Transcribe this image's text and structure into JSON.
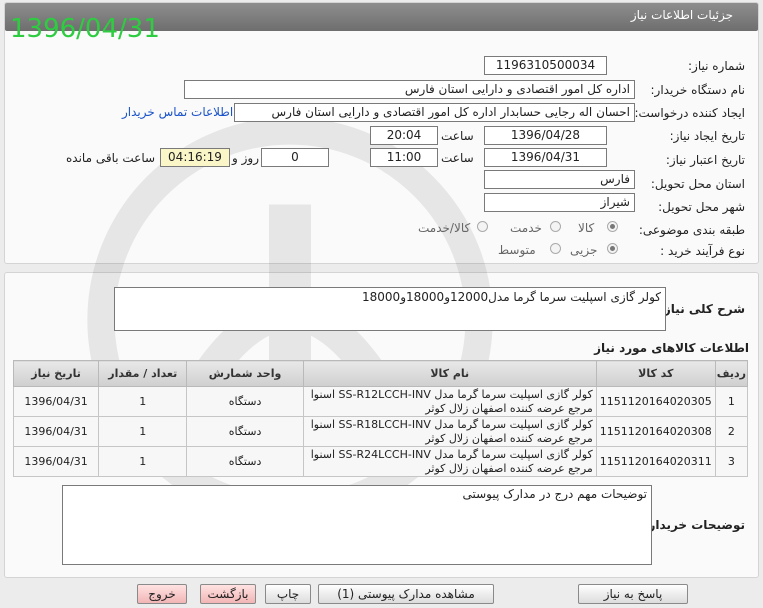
{
  "header": {
    "title": "جزئیات اطلاعات نیاز"
  },
  "stamp_date": "1396/04/31",
  "form": {
    "need_number": {
      "label": "شماره نیاز:",
      "value": "1196310500034"
    },
    "buyer_org": {
      "label": "نام دستگاه خریدار:",
      "value": "اداره کل امور اقتصادی و دارایی استان فارس"
    },
    "requester": {
      "label": "ایجاد کننده درخواست:",
      "value": "احسان اله  رجایی حسابدار اداره کل امور اقتصادی و دارایی استان فارس",
      "contact_link": "اطلاعات تماس خریدار"
    },
    "created": {
      "label": "تاریخ ایجاد نیاز:",
      "date": "1396/04/28",
      "time_label": "ساعت",
      "time": "20:04"
    },
    "validity": {
      "label": "تاریخ اعتبار نیاز:",
      "date": "1396/04/31",
      "time_label": "ساعت",
      "time": "11:00",
      "days": "0",
      "days_label": "روز و",
      "remaining": "04:16:19",
      "remaining_label": "ساعت باقی مانده"
    },
    "province": {
      "label": "استان محل تحویل:",
      "value": "فارس"
    },
    "city": {
      "label": "شهر محل تحویل:",
      "value": "شیراز"
    },
    "category": {
      "label": "طبقه بندی موضوعی:",
      "options": [
        "کالا",
        "خدمت",
        "کالا/خدمت"
      ],
      "selected": 0
    },
    "process": {
      "label": "نوع فرآیند خرید :",
      "options": [
        "جزیی",
        "متوسط"
      ],
      "selected": 0
    }
  },
  "summary": {
    "label": "شرح کلی نیاز:",
    "value": "کولر گازی اسپلیت سرما گرما مدل12000و18000و18000"
  },
  "items_section": {
    "title": "اطلاعات کالاهای مورد نیاز",
    "columns": [
      "ردیف",
      "کد کالا",
      "نام کالا",
      "واحد شمارش",
      "تعداد / مقدار",
      "تاریخ نیاز"
    ],
    "rows": [
      {
        "row": "1",
        "code": "1151120164020305",
        "name_line1": "کولر گازی اسپلیت سرما گرما مدل SS-R12LCCH-INV اسنوا",
        "name_line2": "مرجع عرضه کننده اصفهان زلال کوثر",
        "unit": "دستگاه",
        "qty": "1",
        "date": "1396/04/31"
      },
      {
        "row": "2",
        "code": "1151120164020308",
        "name_line1": "کولر گازی اسپلیت سرما گرما مدل SS-R18LCCH-INV اسنوا",
        "name_line2": "مرجع عرضه کننده اصفهان زلال کوثر",
        "unit": "دستگاه",
        "qty": "1",
        "date": "1396/04/31"
      },
      {
        "row": "3",
        "code": "1151120164020311",
        "name_line1": "کولر گازی اسپلیت سرما گرما مدل SS-R24LCCH-INV اسنوا",
        "name_line2": "مرجع عرضه کننده اصفهان زلال کوثر",
        "unit": "دستگاه",
        "qty": "1",
        "date": "1396/04/31"
      }
    ]
  },
  "buyer_notes": {
    "label": "توضیحات خریدار:",
    "value": "توضیحات مهم درج در مدارک پیوستی"
  },
  "buttons": {
    "reply": "پاسخ به نیاز",
    "attachments": "مشاهده مدارک پیوستی (1)",
    "print": "چاپ",
    "back": "بازگشت",
    "exit": "خروج"
  },
  "colors": {
    "stamp": "#2ecc40",
    "link": "#1a53c9",
    "header": "#7a7a7a"
  }
}
